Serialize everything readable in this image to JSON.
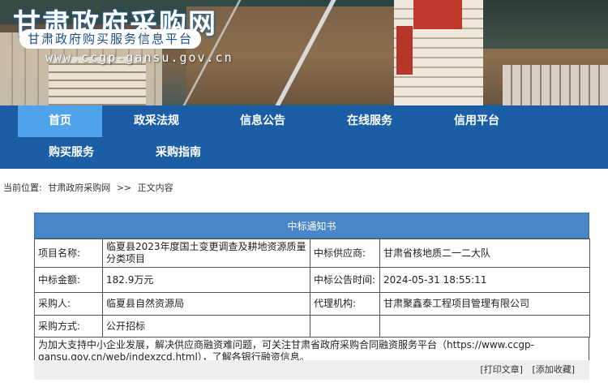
{
  "site": {
    "title": "甘肃政府采购网",
    "subtitle": "甘肃政府购买服务信息平台",
    "url": "www.ccgp-gansu.gov.cn"
  },
  "nav": {
    "items": [
      "首页",
      "政采法规",
      "信息公告",
      "在线服务",
      "信用平台",
      "购买服务",
      "采购指南"
    ],
    "active": "首页"
  },
  "breadcrumb": {
    "prefix": "当前位置:",
    "home": "甘肃政府采购网",
    "separator": ">>",
    "current": "正文内容"
  },
  "notice": {
    "title": "中标通知书",
    "rows": [
      {
        "left_label": "项目名称:",
        "left_value": "临夏县2023年度国土变更调查及耕地资源质量分类项目",
        "right_label": "中标供应商:",
        "right_value": "甘肃省核地质二一二大队"
      },
      {
        "left_label": "中标金额:",
        "left_value": "182.9万元",
        "right_label": "中标公告时间:",
        "right_value": "2024-05-31 18:55:11"
      },
      {
        "left_label": "采购人:",
        "left_value": "临夏县自然资源局",
        "right_label": "代理机构:",
        "right_value": "甘肃聚鑫泰工程项目管理有限公司"
      },
      {
        "left_label": "采购方式:",
        "left_value": "公开招标"
      }
    ],
    "note": "为加大支持中小企业发展，解决供应商融资难问题，可关注甘肃省政府采购合同融资服务平台（https://www.ccgp-gansu.gov.cn/web/indexzcd.html），了解各银行融资信息。"
  },
  "actions": {
    "print": "[打印文章]",
    "favorite": "[添加收藏]"
  },
  "colors": {
    "nav_bg": "#1b5ea6",
    "nav_active": "#4fa3ea",
    "notice_header": "#4a86c7"
  }
}
